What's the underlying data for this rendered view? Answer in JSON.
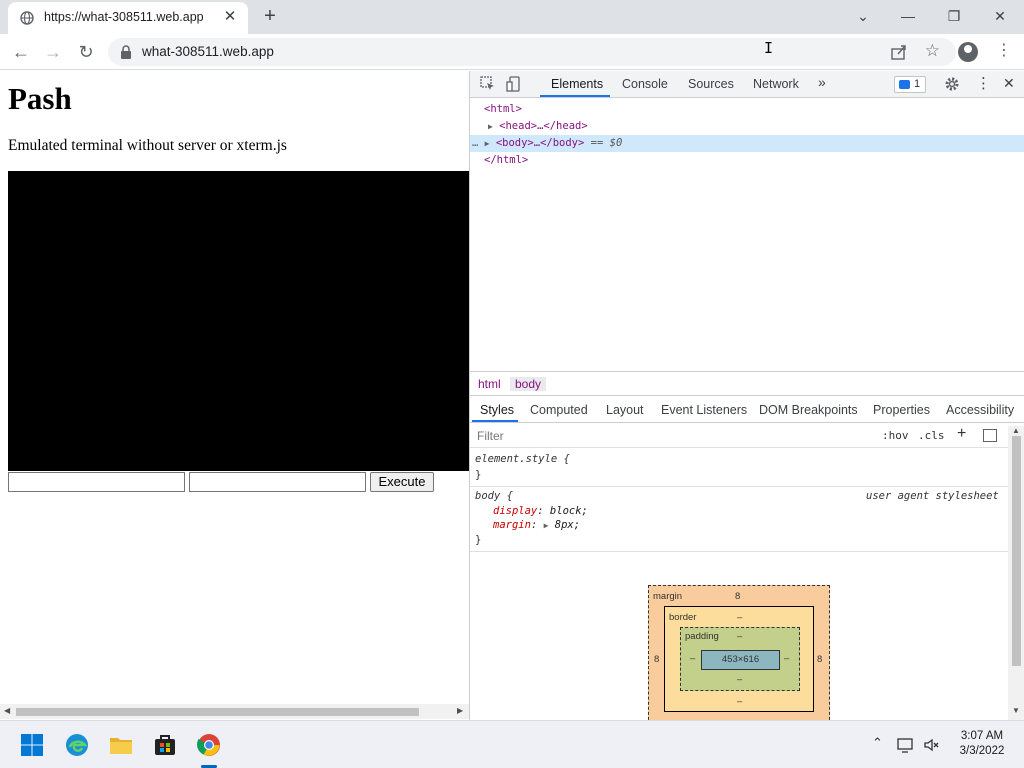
{
  "browser": {
    "tab_title": "https://what-308511.web.app",
    "url": "what-308511.web.app"
  },
  "page": {
    "heading": "Pash",
    "subtitle": "Emulated terminal without server or xterm.js",
    "execute_label": "Execute",
    "input1_value": "",
    "input2_value": ""
  },
  "devtools": {
    "tabs": [
      "Elements",
      "Console",
      "Sources",
      "Network"
    ],
    "more_tabs": "»",
    "issues_count": "1",
    "dom": {
      "html_open": "<html>",
      "head": "<head>…</head>",
      "body": "<body>…</body>",
      "selected_marker": "== $0",
      "html_close": "</html>",
      "ellipsis": "…"
    },
    "breadcrumbs": [
      "html",
      "body"
    ],
    "style_tabs": [
      "Styles",
      "Computed",
      "Layout",
      "Event Listeners",
      "DOM Breakpoints",
      "Properties",
      "Accessibility"
    ],
    "filter_placeholder": "Filter",
    "hov": ":hov",
    "cls": ".cls",
    "rules": {
      "element_style_open": "element.style {",
      "close": "}",
      "body_selector": "body {",
      "ua_label": "user agent stylesheet",
      "display_prop": "display",
      "display_val": "block;",
      "margin_prop": "margin",
      "margin_val": "8px;"
    },
    "box_model": {
      "margin_label": "margin",
      "margin_top": "8",
      "margin_left": "8",
      "margin_right": "8",
      "border_label": "border",
      "border_top": "–",
      "border_bottom": "–",
      "padding_label": "padding",
      "padding_top": "–",
      "padding_bottom": "–",
      "padding_left": "–",
      "padding_right": "–",
      "content": "453×616",
      "bottom_dash": "–"
    }
  },
  "taskbar": {
    "time": "3:07 AM",
    "date": "3/3/2022"
  },
  "colors": {
    "accent": "#1a73e8",
    "tag": "#881280",
    "terminal_bg": "#000000"
  }
}
